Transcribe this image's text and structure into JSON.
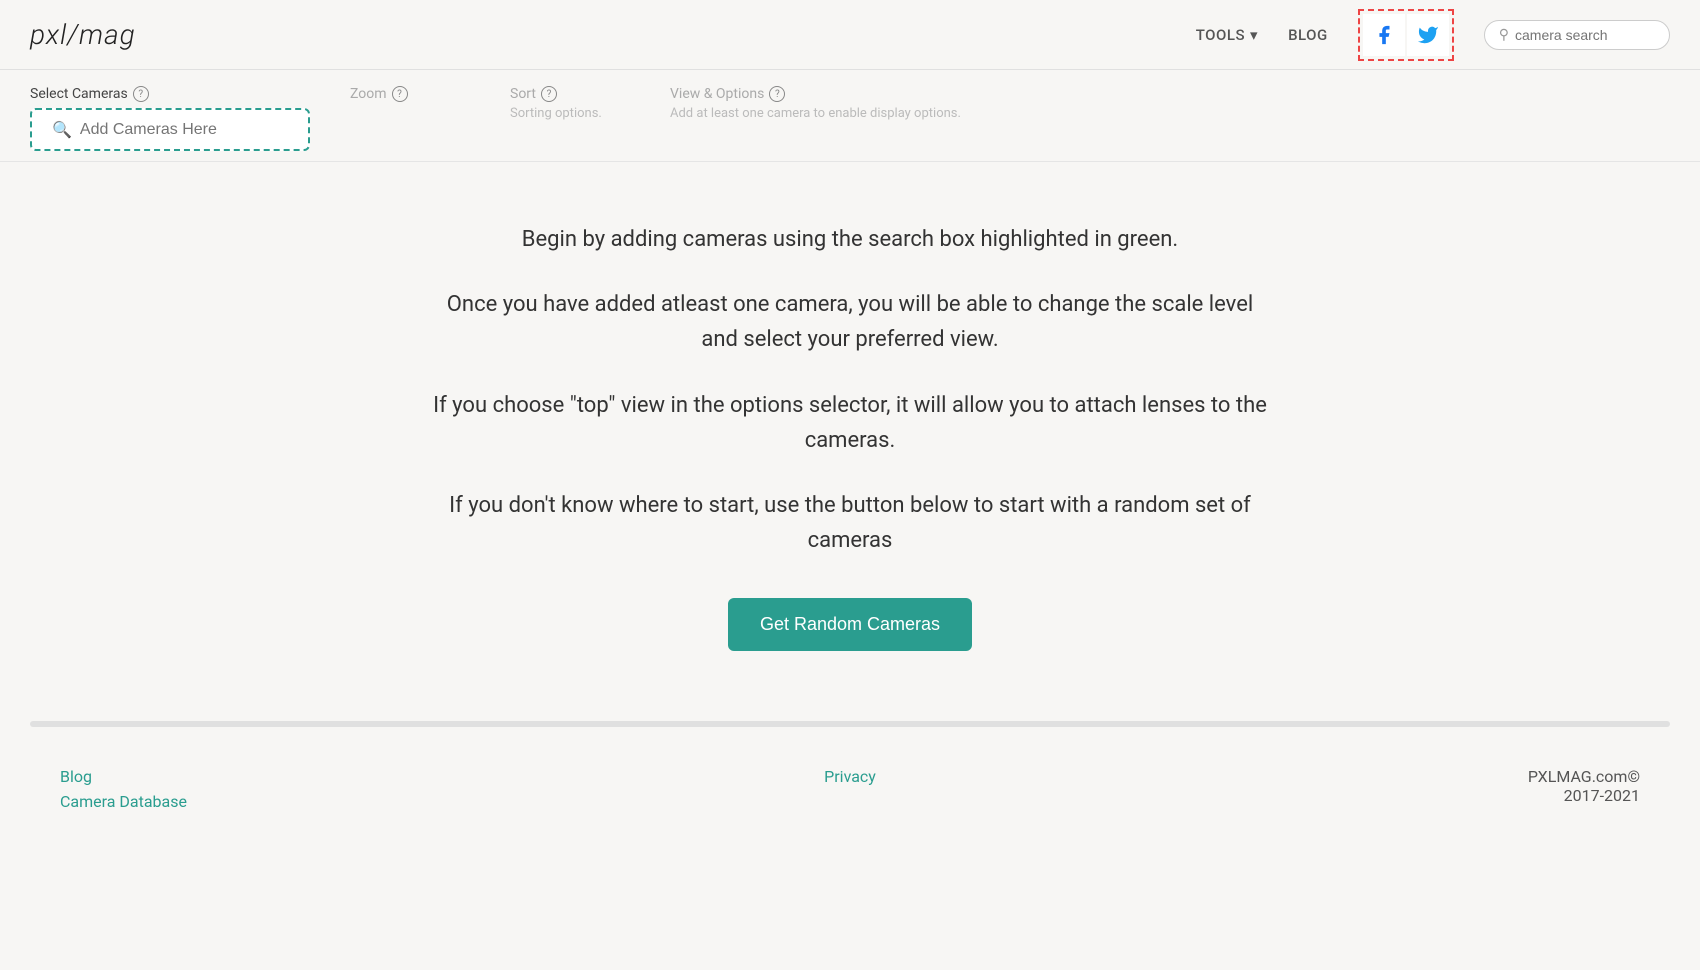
{
  "brand": {
    "logo": "pxl/mag"
  },
  "nav": {
    "tools_label": "TOOLS",
    "blog_label": "BLOG",
    "chevron": "▾",
    "facebook_icon": "f",
    "twitter_icon": "🐦",
    "search_placeholder": "camera search"
  },
  "toolbar": {
    "select_cameras_label": "Select Cameras",
    "select_cameras_placeholder": "Add Cameras Here",
    "zoom_label": "Zoom",
    "sort_label": "Sort",
    "sort_sub": "Sorting options.",
    "view_options_label": "View & Options",
    "view_options_sub": "Add at least one camera to enable display options."
  },
  "main": {
    "line1": "Begin by adding cameras using the search box highlighted in green.",
    "line2": "Once you have added atleast one camera, you will be able to change the scale level and select your preferred view.",
    "line3": "If you choose \"top\" view in the options selector, it will allow you to attach lenses to the cameras.",
    "line4": "If you don't know where to start, use the button below to start with a random set of cameras",
    "random_button": "Get Random Cameras"
  },
  "footer": {
    "links": [
      {
        "label": "Blog"
      },
      {
        "label": "Camera Database"
      }
    ],
    "center_link": "Privacy",
    "copyright_line1": "PXLMAG.com©",
    "copyright_line2": "2017-2021"
  },
  "colors": {
    "teal": "#2a9d8f",
    "teal_dashed": "#2a9d8f",
    "red_dashed": "#e44444",
    "facebook": "#1877f2",
    "twitter": "#1da1f2"
  }
}
